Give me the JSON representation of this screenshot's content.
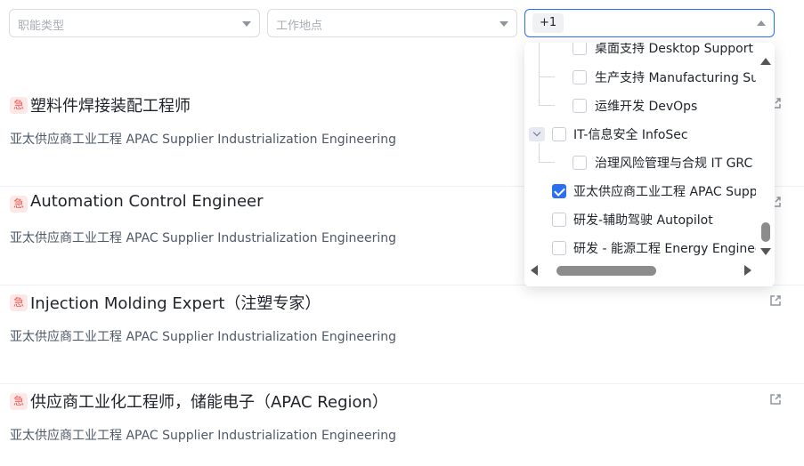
{
  "filters": {
    "function_placeholder": "职能类型",
    "location_placeholder": "工作地点",
    "selected_tag": "+1"
  },
  "jobs": [
    {
      "urgent": "急",
      "title": "塑料件焊接装配工程师",
      "dept": "亚太供应商工业工程 APAC Supplier Industrialization Engineering"
    },
    {
      "urgent": "急",
      "title": "Automation Control Engineer",
      "dept": "亚太供应商工业工程 APAC Supplier Industrialization Engineering"
    },
    {
      "urgent": "急",
      "title": "Injection Molding Expert（注塑专家）",
      "dept": "亚太供应商工业工程 APAC Supplier Industrialization Engineering"
    },
    {
      "urgent": "急",
      "title": "供应商工业化工程师，储能电子（APAC Region）",
      "dept": "亚太供应商工业工程 APAC Supplier Industrialization Engineering"
    }
  ],
  "dropdown": {
    "items": [
      {
        "label": "桌面支持 Desktop Support",
        "checked": false
      },
      {
        "label": "生产支持 Manufacturing Support",
        "checked": false
      },
      {
        "label": "运维开发 DevOps",
        "checked": false
      },
      {
        "label": "IT-信息安全 InfoSec",
        "checked": false
      },
      {
        "label": "治理风险管理与合规 IT GRC",
        "checked": false
      },
      {
        "label": "亚太供应商工业工程 APAC Supplier Industrialization Engineering",
        "checked": true
      },
      {
        "label": "研发-辅助驾驶 Autopilot",
        "checked": false
      },
      {
        "label": "研发 - 能源工程 Energy Engineering",
        "checked": false
      }
    ]
  },
  "colors": {
    "accent": "#2b6ff0",
    "urgent": "#ef5a52",
    "urgent_bg": "#fde8e8"
  }
}
